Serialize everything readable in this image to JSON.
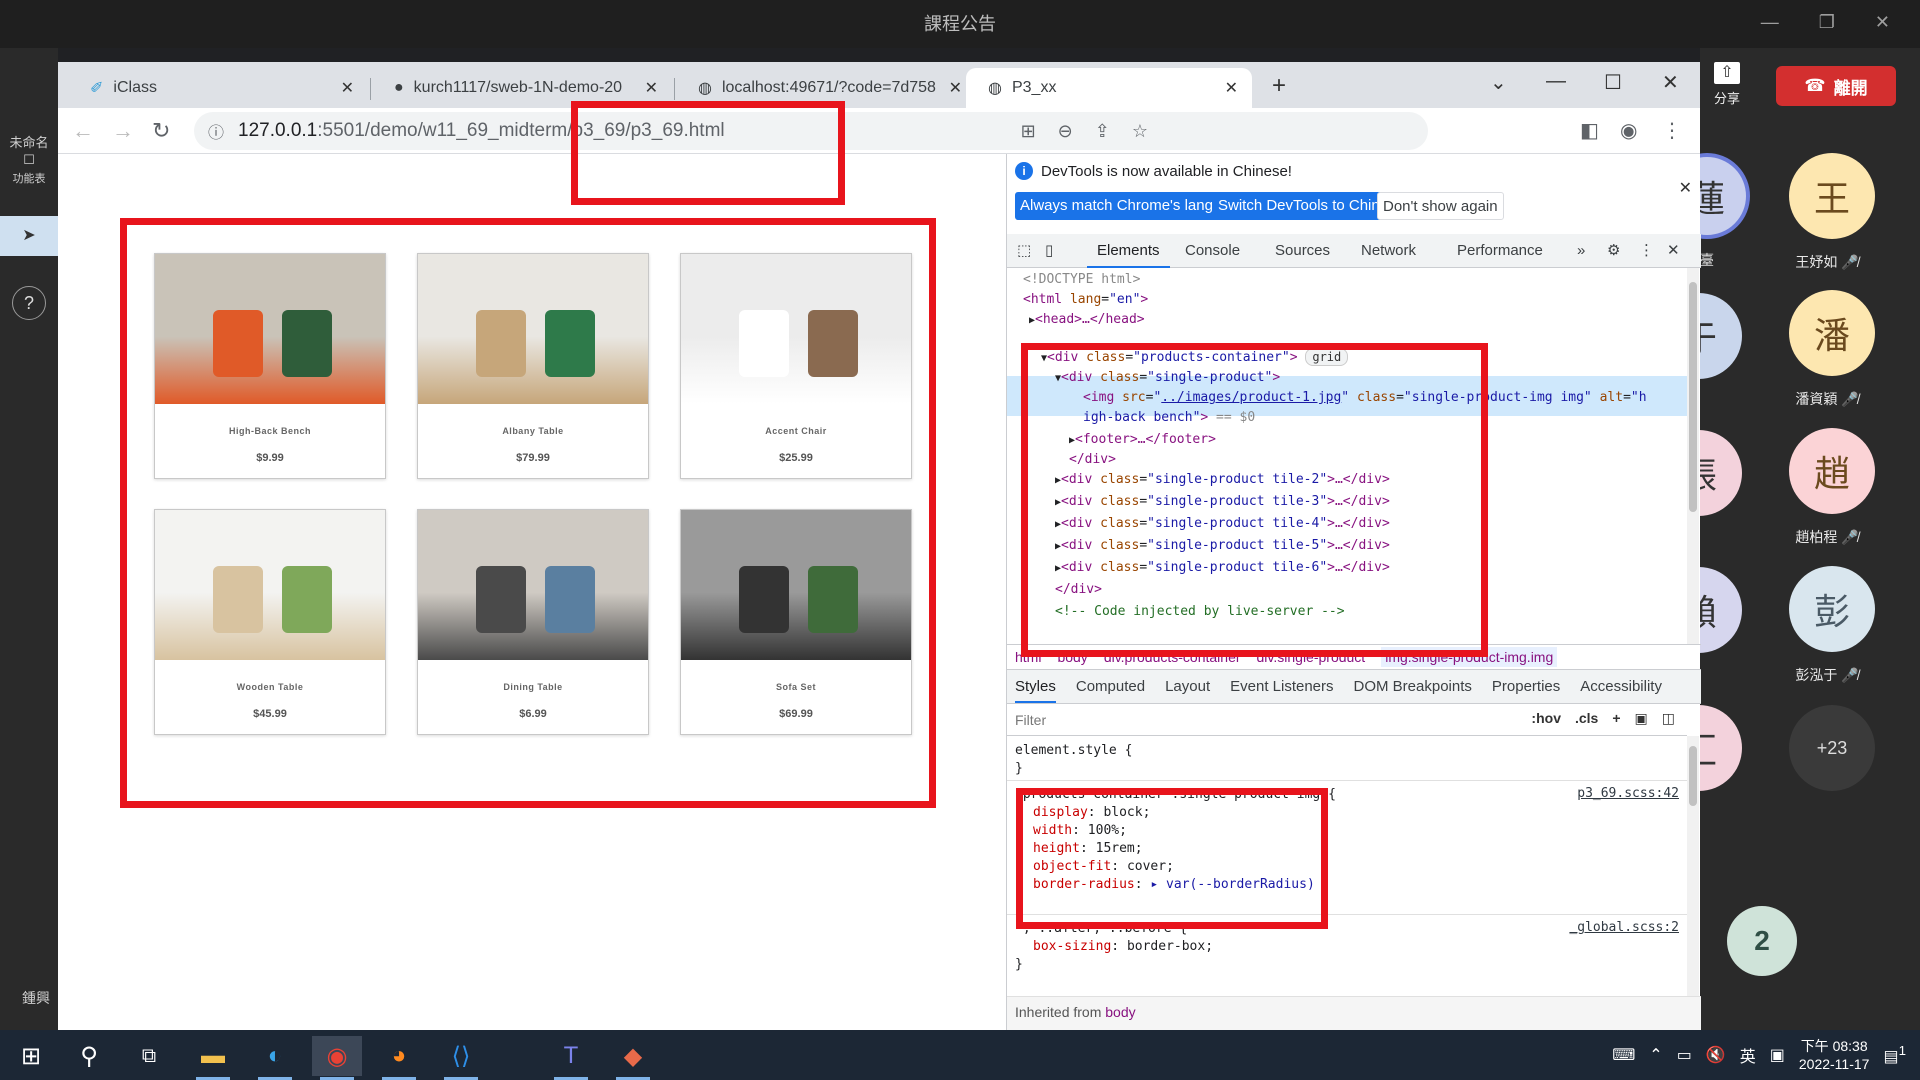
{
  "meeting": {
    "title": "課程公告",
    "window_controls": [
      "—",
      "❐",
      "✕"
    ],
    "left_rail": {
      "top_label": "未命名",
      "func_label": "功能表",
      "help": "?",
      "bottom_label": "鍾興"
    },
    "share_label": "分享",
    "leave_label": "離開",
    "participants": [
      {
        "initial": "王",
        "name": "王妤如",
        "color": "#fde7b0"
      },
      {
        "initial": "潘",
        "name": "潘資穎",
        "color": "#fde7b0"
      },
      {
        "initial": "趙",
        "name": "趙柏程",
        "color": "#fbd3d6"
      },
      {
        "initial": "彭",
        "name": "彭泓于",
        "color": "#d9e6ee"
      }
    ],
    "partial_initials": [
      "蓮",
      "于",
      "張",
      "賴",
      "汇"
    ],
    "partial_label": "臺",
    "more_participants": "+23",
    "speaker_count": "2"
  },
  "browser": {
    "tabs": [
      {
        "title": "iClass",
        "active": false
      },
      {
        "title": "kurch1117/sweb-1N-demo-20",
        "active": false
      },
      {
        "title": "localhost:49671/?code=7d758",
        "active": false
      },
      {
        "title": "P3_xx",
        "active": true
      }
    ],
    "url": "127.0.0.1:5501/demo/w11_69_midterm/p3_69/p3_69.html",
    "url_host": "127.0.0.1",
    "url_path": ":5501/demo/w11_69_midterm/p3_69/p3_69.html"
  },
  "products": [
    {
      "name": "High-Back Bench",
      "price": "$9.99",
      "colors": [
        "#c9c3b8",
        "#e05a28",
        "#2f5d3a"
      ]
    },
    {
      "name": "Albany Table",
      "price": "$79.99",
      "colors": [
        "#e9e7e2",
        "#c6a67a",
        "#2e7a4a"
      ]
    },
    {
      "name": "Accent Chair",
      "price": "$25.99",
      "colors": [
        "#ececec",
        "#ffffff",
        "#8a6a50"
      ]
    },
    {
      "name": "Wooden Table",
      "price": "$45.99",
      "colors": [
        "#f3f3f1",
        "#d8c3a0",
        "#7fa85a"
      ]
    },
    {
      "name": "Dining Table",
      "price": "$6.99",
      "colors": [
        "#cfcac3",
        "#4a4a4a",
        "#5a7fa0"
      ]
    },
    {
      "name": "Sofa Set",
      "price": "$69.99",
      "colors": [
        "#9a9a9a",
        "#333333",
        "#3f6b3a"
      ]
    }
  ],
  "devtools": {
    "info_text": "DevTools is now available in Chinese!",
    "btn_match": "Always match Chrome's language",
    "btn_switch": "Switch DevTools to Chinese",
    "btn_dont": "Don't show again",
    "tabs": [
      "Elements",
      "Console",
      "Sources",
      "Network",
      "Performance"
    ],
    "tabs_more": "»",
    "code": {
      "doctype": "<!DOCTYPE html>",
      "html_open_tag": "<html ",
      "html_attr": "lang",
      "html_val": "\"en\"",
      "head": "<head>…</head>",
      "products_div_tag": "<div ",
      "products_div_attr": "class",
      "products_div_val": "\"products-container\"",
      "grid_badge": "grid",
      "single_div_val": "\"single-product\"",
      "img_src_val": "../images/product-1.jpg",
      "img_class_val": "\"single-product-img img\"",
      "img_alt_val_1": "\"h",
      "img_alt_val_2": "igh-back bench\"",
      "img_eq": " == $0",
      "footer": "<footer>…</footer>",
      "div_close": "</div>",
      "tiles": [
        "\"single-product tile-2\"",
        "\"single-product tile-3\"",
        "\"single-product tile-4\"",
        "\"single-product tile-5\"",
        "\"single-product tile-6\""
      ],
      "tile_tail": ">…</div>",
      "comment": "<!-- Code injected by live-server -->"
    },
    "breadcrumbs": [
      "html",
      "body",
      "div.products-container",
      "div.single-product",
      "img.single-product-img.img"
    ],
    "styles_tabs": [
      "Styles",
      "Computed",
      "Layout",
      "Event Listeners",
      "DOM Breakpoints",
      "Properties",
      "Accessibility"
    ],
    "filter_placeholder": "Filter",
    "filter_hov": ":hov",
    "filter_cls": ".cls",
    "element_style": "element.style {",
    "close_brace": "}",
    "rule_selector": ".products-container .single-product-img {",
    "rule_source": "p3_69.scss:42",
    "rule_props": [
      {
        "name": "display",
        "value": "block;"
      },
      {
        "name": "width",
        "value": "100%;"
      },
      {
        "name": "height",
        "value": "15rem;"
      },
      {
        "name": "object-fit",
        "value": "cover;"
      },
      {
        "name": "border-radius",
        "value": "▸ var(--borderRadius)"
      }
    ],
    "global_selector": "*, ::after, ::before {",
    "global_source": "_global.scss:2",
    "global_prop": {
      "name": "box-sizing",
      "value": "border-box;"
    },
    "inherited_label": "Inherited from",
    "inherited_from": "body"
  },
  "taskbar": {
    "clock_time": "下午 08:38",
    "clock_date": "2022-11-17",
    "ime": "英",
    "notif_count": "1"
  }
}
